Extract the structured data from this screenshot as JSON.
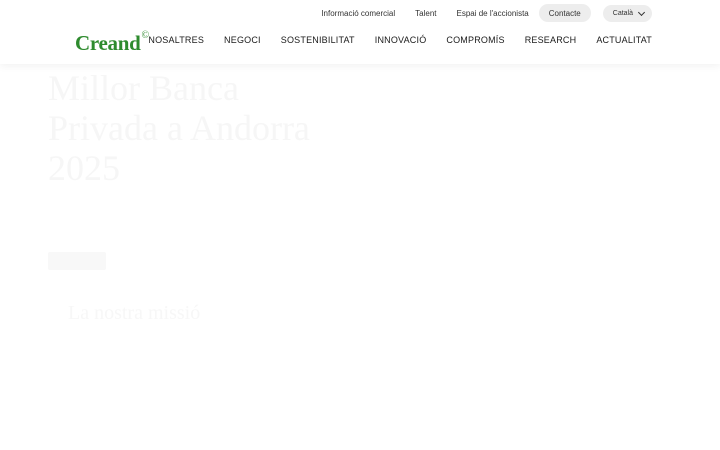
{
  "brand": {
    "name": "Creand",
    "mark": "©",
    "color": "#2e8b2e"
  },
  "top_bar": {
    "links": [
      "Informació comercial",
      "Talent",
      "Espai de l'accionista"
    ],
    "contact_label": "Contacte",
    "language_label": "Català"
  },
  "nav": {
    "items": [
      "NOSALTRES",
      "NEGOCI",
      "SOSTENIBILITAT",
      "INNOVACIÓ",
      "COMPROMÍS",
      "RESEARCH",
      "ACTUALITAT"
    ]
  },
  "hero": {
    "title_lines": [
      "Millor Banca",
      "Privada a Andorra",
      "2025"
    ],
    "subtitle": "La nostra missió"
  }
}
